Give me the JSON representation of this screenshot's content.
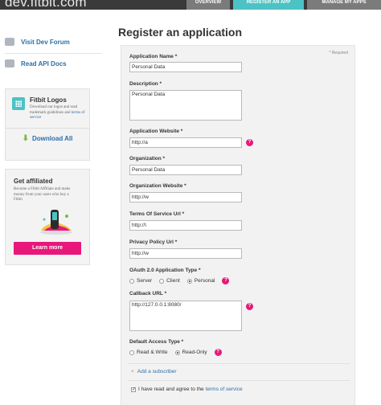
{
  "header": {
    "brand": "dev.fitbit.com",
    "tabs": [
      {
        "label": "OVERVIEW",
        "active": false
      },
      {
        "label": "REGISTER AN APP",
        "active": true
      },
      {
        "label": "MANAGE MY APPS",
        "active": false
      }
    ],
    "colors": {
      "bar": "#3a3a3a",
      "active_tab": "#4cc2c4",
      "tab": "#7b7b7b"
    }
  },
  "sidebar": {
    "links": [
      {
        "label": "Visit Dev Forum",
        "icon": "chat-bubble-icon"
      },
      {
        "label": "Read API Docs",
        "icon": "document-icon"
      }
    ],
    "logos_card": {
      "title": "Fitbit Logos",
      "desc_prefix": "Download our logos and read trademark guidelines and",
      "desc_link": "terms of service",
      "download_label": "Download All"
    },
    "affiliate_card": {
      "title": "Get affiliated",
      "desc": "Become a Fitbit Affiliate and make money from your users who buy a Fitbit",
      "button": "Learn more"
    }
  },
  "main": {
    "title": "Register an application",
    "required_note": "* Required",
    "fields": {
      "app_name": {
        "label": "Application Name *",
        "value": "Personal Data"
      },
      "description": {
        "label": "Description *",
        "value": "Personal Data"
      },
      "app_website": {
        "label": "Application Website *",
        "value": "http://a"
      },
      "organization": {
        "label": "Organization *",
        "value": "Personal Data"
      },
      "org_website": {
        "label": "Organization Website *",
        "value": "http://w"
      },
      "tos_url": {
        "label": "Terms Of Service Url *",
        "value": "http://\\"
      },
      "privacy_url": {
        "label": "Privacy Policy Url *",
        "value": "http://w"
      },
      "callback_url": {
        "label": "Callback URL *",
        "value": "http://127.0.0.1:8080/"
      }
    },
    "oauth": {
      "label": "OAuth 2.0 Application Type *",
      "options": [
        "Server",
        "Client",
        "Personal"
      ],
      "selected": "Personal"
    },
    "access": {
      "label": "Default Access Type *",
      "options": [
        "Read & Write",
        "Read-Only"
      ],
      "selected": "Read-Only"
    },
    "add_subscriber": "Add a subscriber",
    "agree_prefix": "I have read and agree to the",
    "agree_link": "terms of service",
    "agree_checked": true,
    "help_glyph": "?"
  }
}
